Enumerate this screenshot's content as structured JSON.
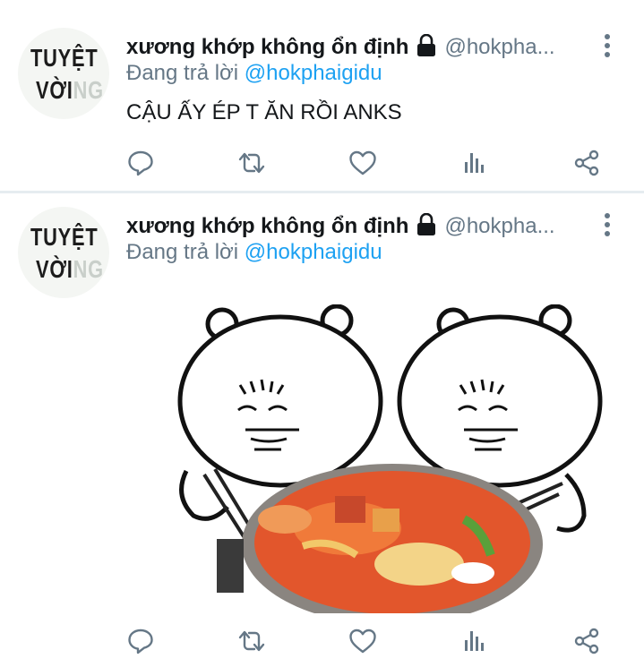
{
  "tweets": [
    {
      "avatar_text_line1": "TUYỆT",
      "avatar_text_line2a": "VỜI",
      "avatar_text_line2b": "NG",
      "display_name": "xương khớp không ổn định",
      "handle": "@hokpha...",
      "reply_prefix": "Đang trả lời",
      "reply_to": "@hokphaigidu",
      "text": "CẬU ẤY ÉP T ĂN RỒI ANKS",
      "icons": [
        "lock-icon",
        "more-vert-icon",
        "reply-icon",
        "retweet-icon",
        "like-icon",
        "analytics-icon",
        "share-icon"
      ]
    },
    {
      "avatar_text_line1": "TUYỆT",
      "avatar_text_line2a": "VỜI",
      "avatar_text_line2b": "NG",
      "display_name": "xương khớp không ổn định",
      "handle": "@hokpha...",
      "reply_prefix": "Đang trả lời",
      "reply_to": "@hokphaigidu",
      "media": "sticker-image",
      "icons": [
        "lock-icon",
        "more-vert-icon",
        "reply-icon",
        "retweet-icon",
        "like-icon",
        "analytics-icon",
        "share-icon"
      ]
    }
  ],
  "colors": {
    "text": "#14171a",
    "secondary": "#657786",
    "accent": "#1da1f2",
    "divider": "#e6ecf0"
  }
}
